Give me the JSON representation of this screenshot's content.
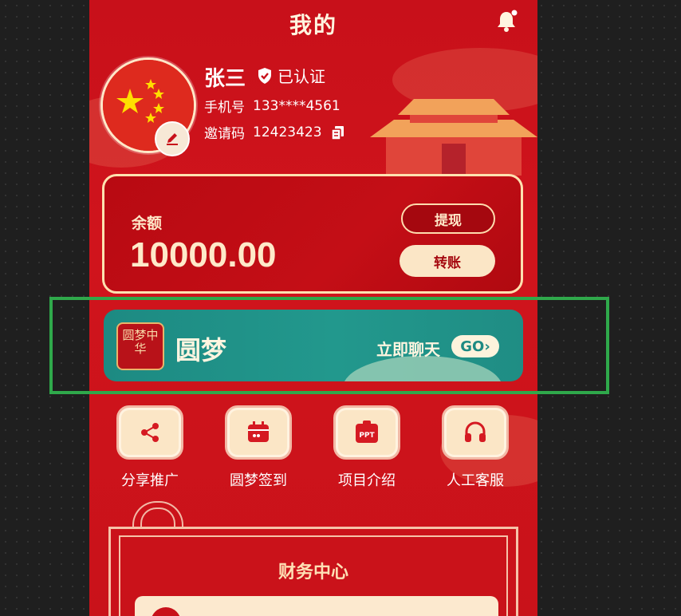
{
  "header": {
    "title": "我的"
  },
  "profile": {
    "name": "张三",
    "verified_label": "已认证",
    "phone_label": "手机号",
    "phone_value": "133****4561",
    "invite_label": "邀请码",
    "invite_value": "12423423"
  },
  "balance": {
    "label": "余额",
    "value": "10000.00",
    "withdraw_label": "提现",
    "transfer_label": "转账"
  },
  "banner": {
    "logo_text": "圆梦中华",
    "title": "圆梦",
    "cta": "立即聊天",
    "go_label": "GO›"
  },
  "menu": [
    {
      "label": "分享推广",
      "icon": "share-icon"
    },
    {
      "label": "圆梦签到",
      "icon": "calendar-icon"
    },
    {
      "label": "项目介绍",
      "icon": "ppt-icon"
    },
    {
      "label": "人工客服",
      "icon": "headphones-icon"
    }
  ],
  "finance": {
    "title": "财务中心"
  },
  "colors": {
    "primary_red": "#c8101a",
    "cream": "#fbe6c6",
    "teal": "#1d8a82",
    "highlight_green": "#2fa94b"
  }
}
